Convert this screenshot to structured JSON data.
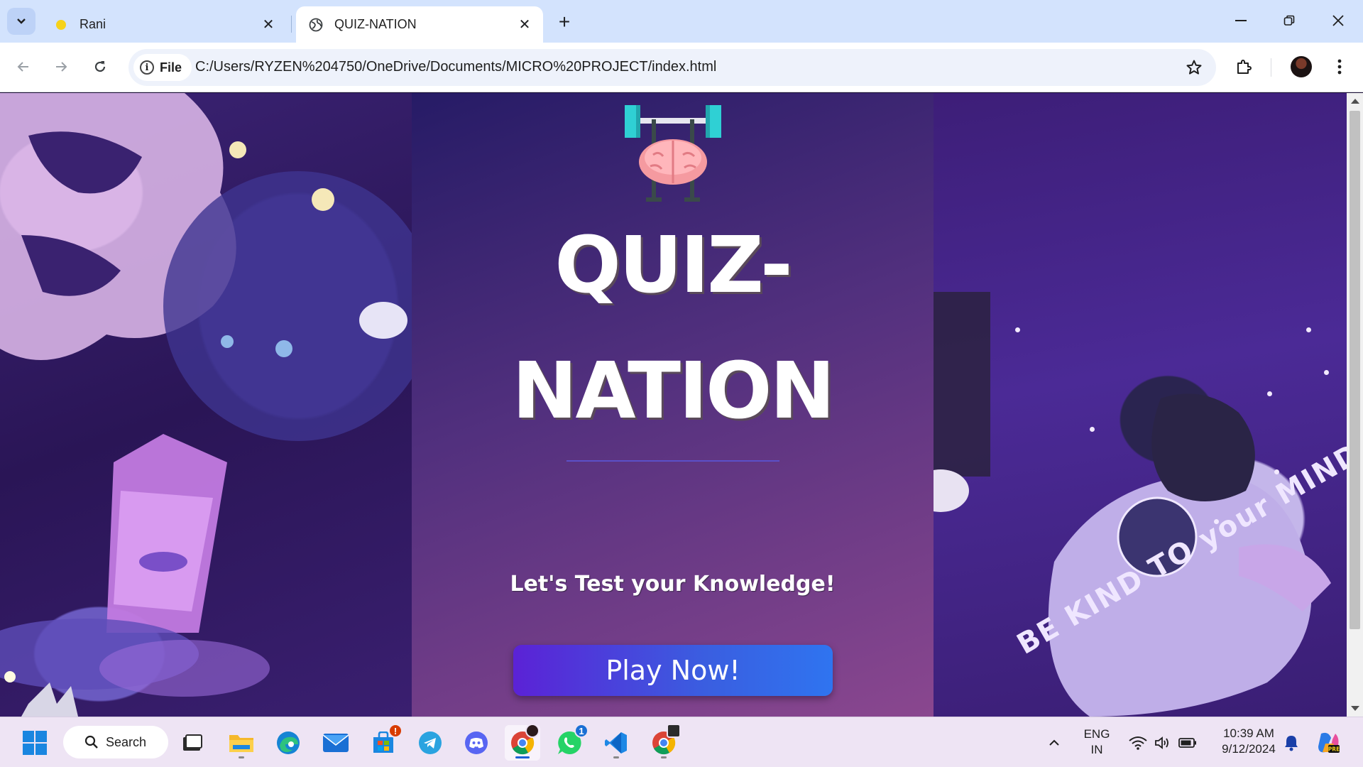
{
  "browser": {
    "tabs": [
      {
        "title": "Rani",
        "active": false,
        "favicon": "yellow-dot-icon"
      },
      {
        "title": "QUIZ-NATION",
        "active": true,
        "favicon": "globe-icon"
      }
    ],
    "site_chip": "File",
    "url": "C:/Users/RYZEN%204750/OneDrive/Documents/MICRO%20PROJECT/index.html"
  },
  "page": {
    "title_line1": "QUIZ-",
    "title_line2": "NATION",
    "tagline": "Let's Test your Knowledge!",
    "play_button": "Play Now!",
    "poster_text": "BE KIND TO your MIND"
  },
  "taskbar": {
    "search_label": "Search",
    "badges": {
      "store": "!",
      "whatsapp": "1"
    },
    "language_line1": "ENG",
    "language_line2": "IN",
    "time": "10:39 AM",
    "date": "9/12/2024"
  },
  "colors": {
    "accent": "#1a5fd6",
    "play_start": "#5b22d6",
    "play_end": "#2f74f0",
    "center_top": "#261b66",
    "center_bottom": "#8a478f"
  }
}
